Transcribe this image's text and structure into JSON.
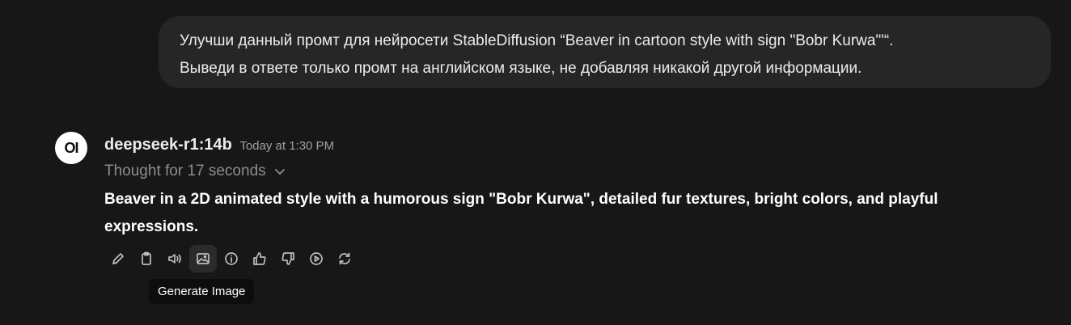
{
  "user_message": {
    "lines": [
      "Улучши данный промт для нейросети StableDiffusion “Beaver in cartoon style with sign \"Bobr Kurwa\"'“.",
      "Выведи в ответе только промт на английском языке, не добавляя никакой другой информации."
    ]
  },
  "assistant": {
    "avatar_text": "OI",
    "model_name": "deepseek-r1:14b",
    "timestamp": "Today at 1:30 PM",
    "thought_label": "Thought for 17 seconds",
    "response": "Beaver in a 2D animated style with a humorous sign \"Bobr Kurwa\", detailed fur textures, bright colors, and playful expressions."
  },
  "toolbar": {
    "icons": [
      "pencil-icon",
      "clipboard-icon",
      "speaker-icon",
      "image-icon",
      "info-icon",
      "thumbs-up-icon",
      "thumbs-down-icon",
      "play-icon",
      "refresh-icon"
    ],
    "active": "image-icon"
  },
  "tooltip": {
    "text": "Generate Image"
  }
}
